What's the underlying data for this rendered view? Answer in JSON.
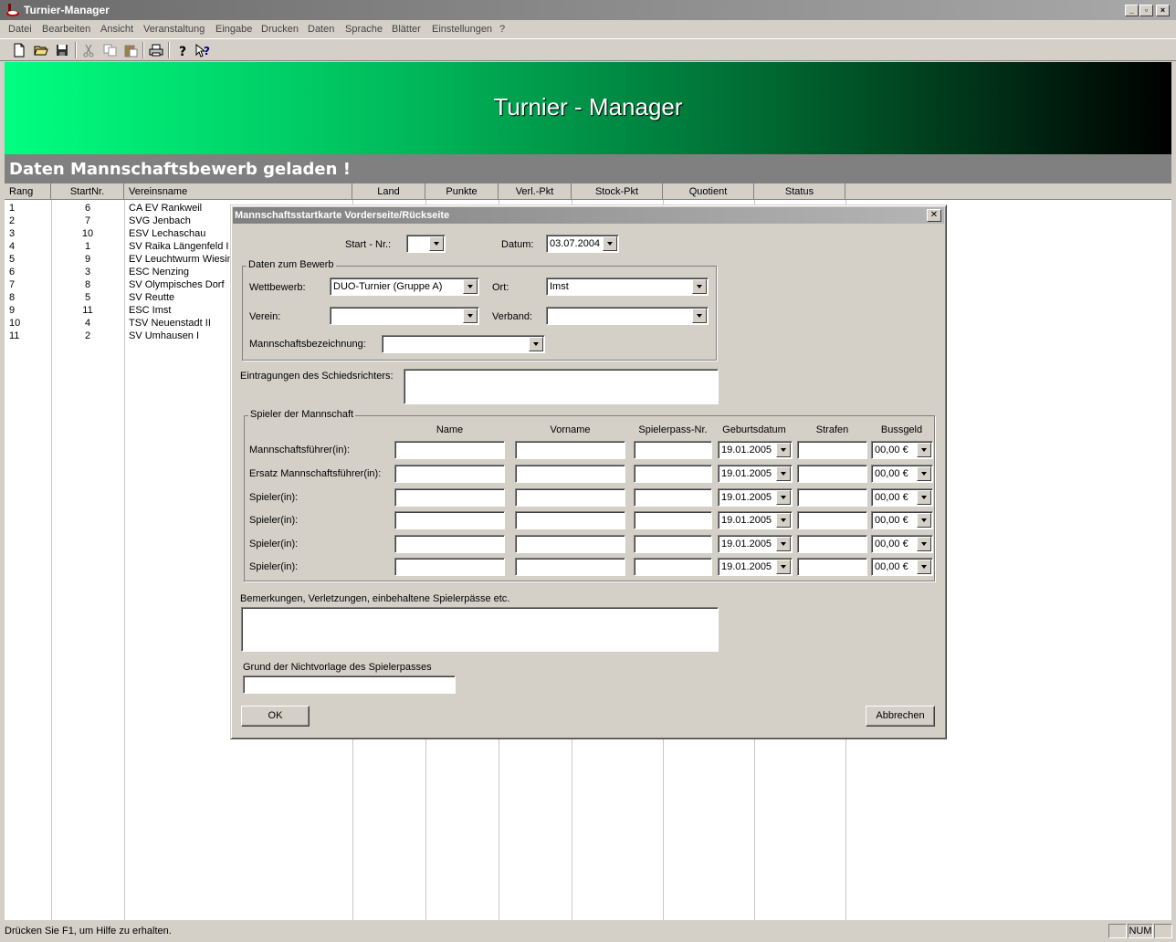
{
  "window": {
    "title": "Turnier-Manager"
  },
  "menu": [
    "Datei",
    "Bearbeiten",
    "Ansicht",
    "Veranstaltung",
    "Eingabe",
    "Drucken",
    "Daten",
    "Sprache",
    "Blätter",
    "Einstellungen",
    "?"
  ],
  "toolbar": {
    "icons": [
      "new-file-icon",
      "open-folder-icon",
      "save-icon",
      "cut-icon",
      "copy-icon",
      "paste-icon",
      "print-icon",
      "help-icon",
      "context-help-icon"
    ]
  },
  "banner": {
    "title": "Turnier - Manager",
    "status": "Daten Mannschaftsbewerb geladen !"
  },
  "grid": {
    "columns": [
      "Rang",
      "StartNr.",
      "Vereinsname",
      "Land",
      "Punkte",
      "Verl.-Pkt",
      "Stock-Pkt",
      "Quotient",
      "Status"
    ],
    "rows": [
      {
        "rang": "1",
        "startnr": "6",
        "verein": "CA EV Rankweil"
      },
      {
        "rang": "2",
        "startnr": "7",
        "verein": "SVG Jenbach"
      },
      {
        "rang": "3",
        "startnr": "10",
        "verein": "ESV Lechaschau"
      },
      {
        "rang": "4",
        "startnr": "1",
        "verein": "SV Raika Längenfeld I"
      },
      {
        "rang": "5",
        "startnr": "9",
        "verein": "EV Leuchtwurm Wiesing"
      },
      {
        "rang": "6",
        "startnr": "3",
        "verein": "ESC Nenzing"
      },
      {
        "rang": "7",
        "startnr": "8",
        "verein": "SV Olympisches Dorf"
      },
      {
        "rang": "8",
        "startnr": "5",
        "verein": "SV Reutte"
      },
      {
        "rang": "9",
        "startnr": "11",
        "verein": "ESC Imst"
      },
      {
        "rang": "10",
        "startnr": "4",
        "verein": "TSV Neuenstadt II"
      },
      {
        "rang": "11",
        "startnr": "2",
        "verein": "SV Umhausen I"
      }
    ]
  },
  "statusbar": {
    "message": "Drücken Sie F1, um Hilfe zu erhalten.",
    "num": "NUM"
  },
  "dialog": {
    "title": "Mannschaftsstartkarte Vorderseite/Rückseite",
    "start_nr": {
      "label": "Start - Nr.:",
      "value": ""
    },
    "datum": {
      "label": "Datum:",
      "value": "03.07.2004"
    },
    "bewerb": {
      "group_title": "Daten zum Bewerb",
      "wettbewerb": {
        "label": "Wettbewerb:",
        "value": "DUO-Turnier (Gruppe A)"
      },
      "ort": {
        "label": "Ort:",
        "value": "Imst"
      },
      "verein": {
        "label": "Verein:",
        "value": ""
      },
      "verband": {
        "label": "Verband:",
        "value": ""
      },
      "mannschaft": {
        "label": "Mannschaftsbezeichnung:",
        "value": ""
      }
    },
    "schiedsrichter": {
      "label": "Eintragungen des Schiedsrichters:",
      "value": ""
    },
    "spieler": {
      "group_title": "Spieler der Mannschaft",
      "columns": [
        "Name",
        "Vorname",
        "Spielerpass-Nr.",
        "Geburtsdatum",
        "Strafen",
        "Bussgeld"
      ],
      "rows": [
        {
          "label": "Mannschaftsführer(in):",
          "name": "",
          "vorname": "",
          "pass": "",
          "geburt": "19.01.2005",
          "strafen": "",
          "bussgeld": "00,00 €"
        },
        {
          "label": "Ersatz Mannschaftsführer(in):",
          "name": "",
          "vorname": "",
          "pass": "",
          "geburt": "19.01.2005",
          "strafen": "",
          "bussgeld": "00,00 €"
        },
        {
          "label": "Spieler(in):",
          "name": "",
          "vorname": "",
          "pass": "",
          "geburt": "19.01.2005",
          "strafen": "",
          "bussgeld": "00,00 €"
        },
        {
          "label": "Spieler(in):",
          "name": "",
          "vorname": "",
          "pass": "",
          "geburt": "19.01.2005",
          "strafen": "",
          "bussgeld": "00,00 €"
        },
        {
          "label": "Spieler(in):",
          "name": "",
          "vorname": "",
          "pass": "",
          "geburt": "19.01.2005",
          "strafen": "",
          "bussgeld": "00,00 €"
        },
        {
          "label": "Spieler(in):",
          "name": "",
          "vorname": "",
          "pass": "",
          "geburt": "19.01.2005",
          "strafen": "",
          "bussgeld": "00,00 €"
        }
      ]
    },
    "bemerkungen": {
      "label": "Bemerkungen, Verletzungen, einbehaltene Spielerpässe etc.",
      "value": ""
    },
    "grund": {
      "label": "Grund der Nichtvorlage des Spielerpasses",
      "value": ""
    },
    "ok_label": "OK",
    "cancel_label": "Abbrechen"
  }
}
